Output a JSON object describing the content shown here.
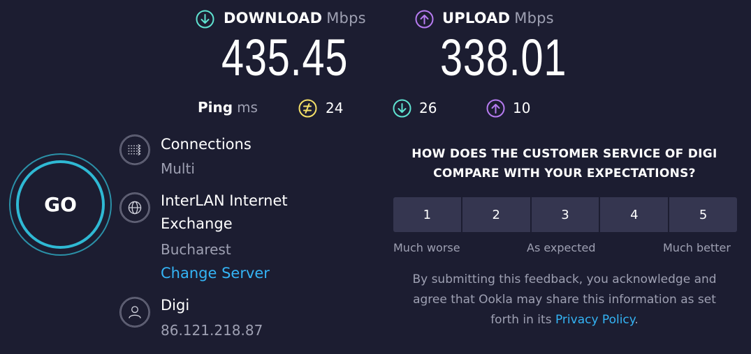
{
  "download": {
    "label": "DOWNLOAD",
    "unit": "Mbps",
    "value": "435.45",
    "icon": "arrow-down-circle-icon",
    "color": "#5fe3d1"
  },
  "upload": {
    "label": "UPLOAD",
    "unit": "Mbps",
    "value": "338.01",
    "icon": "arrow-up-circle-icon",
    "color": "#b67bf0"
  },
  "ping": {
    "label": "Ping",
    "unit": "ms",
    "idle": "24",
    "down": "26",
    "up": "10",
    "idle_color": "#f5e067"
  },
  "go": {
    "label": "GO"
  },
  "connections": {
    "title": "Connections",
    "value": "Multi"
  },
  "server": {
    "name_line1": "InterLAN Internet",
    "name_line2": "Exchange",
    "location": "Bucharest",
    "change_label": "Change Server"
  },
  "isp": {
    "name": "Digi",
    "ip": "86.121.218.87"
  },
  "survey": {
    "question_line1": "HOW DOES THE CUSTOMER SERVICE OF DIGI",
    "question_line2": "COMPARE WITH YOUR EXPECTATIONS?",
    "ratings": [
      "1",
      "2",
      "3",
      "4",
      "5"
    ],
    "scale_low": "Much worse",
    "scale_mid": "As expected",
    "scale_high": "Much better",
    "disclaimer_line1": "By submitting this feedback, you acknowledge and",
    "disclaimer_line2": "agree that Ookla may share this information as set",
    "disclaimer_prefix": "forth in its ",
    "privacy_link": "Privacy Policy",
    "disclaimer_suffix": "."
  }
}
